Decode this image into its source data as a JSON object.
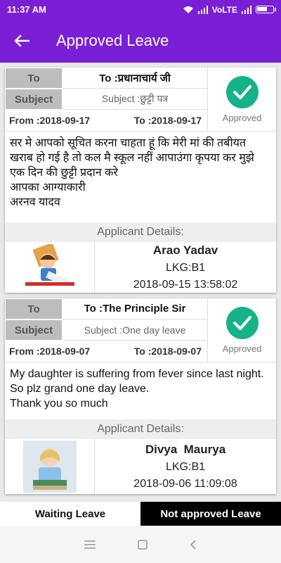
{
  "status_bar": {
    "time": "11:37 AM",
    "network": "VoLTE"
  },
  "app_bar": {
    "title": "Approved Leave"
  },
  "leaves": [
    {
      "to_label": "To",
      "to_value": "To :प्रधानाचार्य जी",
      "subject_label": "Subject",
      "subject_value": "Subject :छुट्टी पत्र",
      "from_date": "From :2018-09-17",
      "to_date": "To :2018-09-17",
      "status": "Approved",
      "message": "सर मे आपको सूचित करना चाहता हूं कि मेरी मां की तबीयत खराब हो गई है तो कल मै स्कूल नहीं आपाउंगा कृपया कर मुझे एक दिन की छुट्टी प्रदान करे\nआपका आग्याकारी\nअरनव यादव",
      "applicant_header": "Applicant Details:",
      "applicant_name": "Arao Yadav",
      "applicant_class": "LKG:B1",
      "applied_at": "2018-09-15 13:58:02"
    },
    {
      "to_label": "To",
      "to_value": "To :The Principle Sir",
      "subject_label": "Subject",
      "subject_value": "Subject :One day leave",
      "from_date": "From :2018-09-07",
      "to_date": "To :2018-09-07",
      "status": "Approved",
      "message": "My daughter is suffering from fever since last night. So plz grand one day leave.\nThank you so much",
      "applicant_header": "Applicant Details:",
      "applicant_name": "Divya  Maurya",
      "applicant_class": "LKG:B1",
      "applied_at": "2018-09-06 11:09:08"
    }
  ],
  "bottom_tabs": {
    "waiting": "Waiting Leave",
    "not_approved": "Not approved Leave"
  },
  "colors": {
    "primary": "#7a1fd6",
    "approved": "#16b38a"
  }
}
